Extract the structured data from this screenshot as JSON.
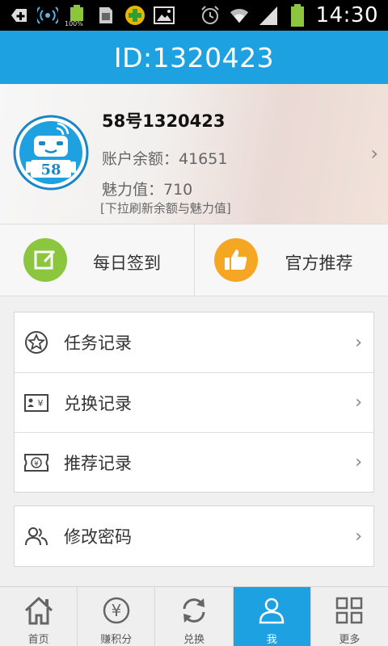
{
  "statusbar": {
    "time": "14:30",
    "battery_small_label": "100%",
    "icons": [
      "add-icon",
      "wifi-signal-icon",
      "battery-full-icon",
      "sim-card-icon",
      "game-icon",
      "image-icon",
      "alarm-icon",
      "wifi-icon",
      "signal-bars-icon",
      "battery-icon"
    ]
  },
  "header": {
    "title": "ID:1320423"
  },
  "profile": {
    "name": "58号1320423",
    "balance": "账户余额：41651",
    "charm": "魅力值：710",
    "hint": "[下拉刷新余额与魅力值]",
    "chevron": "›"
  },
  "actions": [
    {
      "label": "每日签到",
      "icon": "checkin-edit-icon",
      "color": "#8cc63f"
    },
    {
      "label": "官方推荐",
      "icon": "thumbs-up-icon",
      "color": "#f5a623"
    }
  ],
  "menu_group_1": [
    {
      "label": "任务记录",
      "icon": "star-circle-icon",
      "chevron": "›"
    },
    {
      "label": "兑换记录",
      "icon": "yuan-card-icon",
      "chevron": "›"
    },
    {
      "label": "推荐记录",
      "icon": "yuan-ticket-icon",
      "chevron": "›"
    }
  ],
  "menu_group_2": [
    {
      "label": "修改密码",
      "icon": "users-icon",
      "chevron": "›"
    }
  ],
  "tabbar": [
    {
      "label": "首页",
      "icon": "home-icon",
      "active": false
    },
    {
      "label": "赚积分",
      "icon": "yuan-coin-icon",
      "active": false
    },
    {
      "label": "兑换",
      "icon": "refresh-icon",
      "active": false
    },
    {
      "label": "我",
      "icon": "person-icon",
      "active": true
    },
    {
      "label": "更多",
      "icon": "grid-icon",
      "active": false
    }
  ],
  "colors": {
    "accent": "#1ea1e0",
    "checkin": "#8cc63f",
    "recommend": "#f5a623"
  }
}
